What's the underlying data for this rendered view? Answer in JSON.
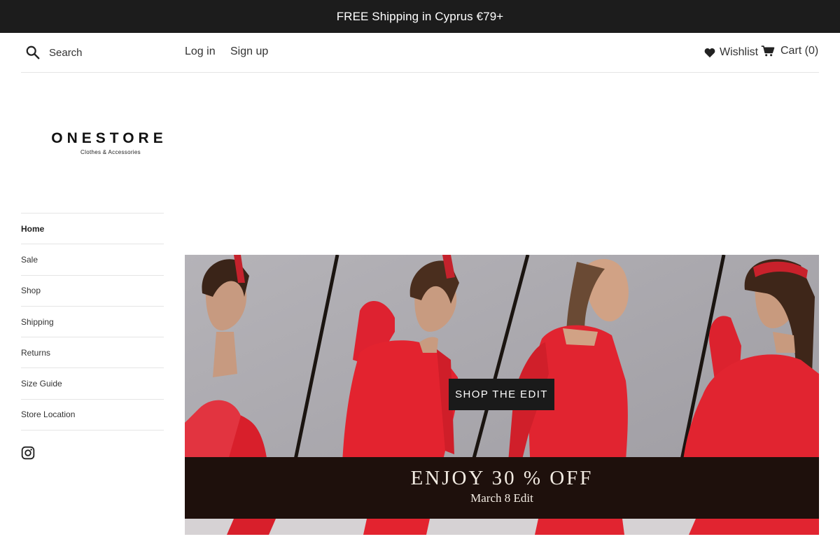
{
  "announcement": {
    "text": "FREE Shipping in Cyprus €79+"
  },
  "header": {
    "search": {
      "placeholder": "Search",
      "icon": "search-icon"
    },
    "login_label": "Log in",
    "signup_label": "Sign up",
    "wishlist_label": "Wishlist",
    "cart_label": "Cart (0)"
  },
  "logo": {
    "name": "ONESTORE",
    "tagline": "Clothes & Accessories"
  },
  "sidebar": {
    "items": [
      {
        "label": "Home",
        "active": true
      },
      {
        "label": "Sale"
      },
      {
        "label": "Shop"
      },
      {
        "label": "Shipping"
      },
      {
        "label": "Returns"
      },
      {
        "label": "Size Guide"
      },
      {
        "label": "Store Location"
      }
    ],
    "social": [
      "instagram-icon"
    ]
  },
  "hero": {
    "button_label": "SHOP THE EDIT",
    "promo_title": "ENJOY 30 % OFF",
    "promo_subtitle": "March 8 Edit"
  },
  "colors": {
    "announcement_bg": "#1c1c1c",
    "button_bg": "#1a1a1a",
    "promo_band": "#1e100c",
    "dress_red": "#e0202c"
  }
}
